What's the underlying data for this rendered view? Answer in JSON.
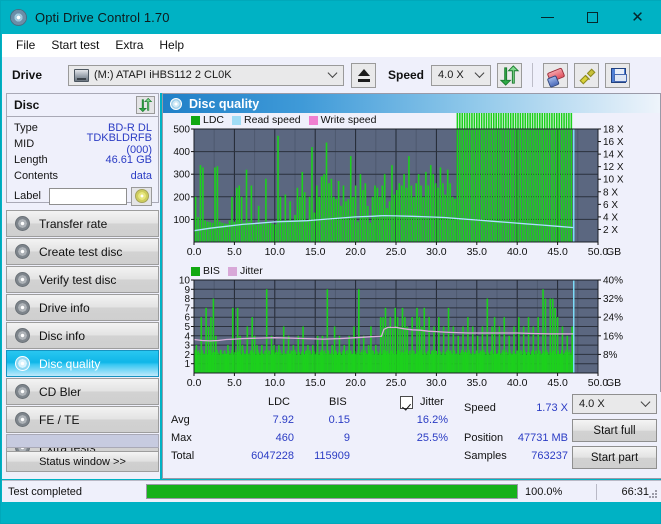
{
  "window": {
    "title": "Opti Drive Control 1.70",
    "icon": "disc-icon",
    "minimize": "minimize-icon",
    "maximize": "maximize-icon",
    "close": "close-icon",
    "titlebar_color": "#00b2c4"
  },
  "menu": [
    {
      "label": "File"
    },
    {
      "label": "Start test"
    },
    {
      "label": "Extra"
    },
    {
      "label": "Help"
    }
  ],
  "toolbar": {
    "drive_label": "Drive",
    "drive_value": "(M:) ATAPI iHBS112  2 CL0K",
    "eject_title": "eject-button",
    "speed_label": "Speed",
    "speed_value": "4.0 X",
    "refresh_title": "refresh-button",
    "erase_title": "erase-button",
    "plug_title": "plug-button",
    "save_title": "save-button"
  },
  "disc": {
    "title": "Disc",
    "rows": [
      {
        "key": "Type",
        "value": "BD-R DL"
      },
      {
        "key": "MID",
        "value": "TDKBLDRFB (000)"
      },
      {
        "key": "Length",
        "value": "46.61 GB"
      },
      {
        "key": "Contents",
        "value": "data"
      }
    ],
    "label_key": "Label",
    "label_value": "",
    "label_placeholder": ""
  },
  "sidebar": {
    "items": [
      {
        "label": "Transfer rate",
        "selected": false
      },
      {
        "label": "Create test disc",
        "selected": false
      },
      {
        "label": "Verify test disc",
        "selected": false
      },
      {
        "label": "Drive info",
        "selected": false
      },
      {
        "label": "Disc info",
        "selected": false
      },
      {
        "label": "Disc quality",
        "selected": true
      },
      {
        "label": "CD Bler",
        "selected": false
      },
      {
        "label": "FE / TE",
        "selected": false
      },
      {
        "label": "Extra tests",
        "selected": false
      }
    ],
    "status_window": "Status window >>"
  },
  "panel": {
    "title": "Disc quality",
    "icon": "disc-quality-icon"
  },
  "stats": {
    "col_ldc": "LDC",
    "col_bis": "BIS",
    "jitter_label": "Jitter",
    "jitter_checked": true,
    "rows": [
      {
        "name": "Avg",
        "ldc": "7.92",
        "bis": "0.15",
        "jitter": "16.2%"
      },
      {
        "name": "Max",
        "ldc": "460",
        "bis": "9",
        "jitter": "25.5%"
      },
      {
        "name": "Total",
        "ldc": "6047228",
        "bis": "115909",
        "jitter": ""
      }
    ],
    "speed_key": "Speed",
    "speed_val": "1.73 X",
    "position_key": "Position",
    "position_val": "47731 MB",
    "samples_key": "Samples",
    "samples_val": "763237",
    "speed_select": "4.0 X",
    "start_full": "Start full",
    "start_part": "Start part"
  },
  "statusbar": {
    "text": "Test completed",
    "percent_label": "100.0%",
    "percent_value": 100,
    "elapsed": "66:31",
    "bar_color": "#16b11a"
  },
  "chart_data": [
    {
      "type": "line",
      "name": "ldc-chart",
      "title": "",
      "xlabel": "GB",
      "ylabel": "",
      "xlim": [
        0,
        50
      ],
      "ylim": [
        0,
        500
      ],
      "y2lim": [
        0,
        18
      ],
      "xticks": [
        "0.0",
        "5.0",
        "10.0",
        "15.0",
        "20.0",
        "25.0",
        "30.0",
        "35.0",
        "40.0",
        "45.0",
        "50.0"
      ],
      "yticks": [
        "100",
        "200",
        "300",
        "400",
        "500"
      ],
      "y2ticks": [
        "2 X",
        "4 X",
        "6 X",
        "8 X",
        "10 X",
        "12 X",
        "14 X",
        "16 X",
        "18 X"
      ],
      "grid": true,
      "legend": [
        {
          "label": "LDC",
          "color": "#11a811"
        },
        {
          "label": "Read speed",
          "color": "#9fdcf5"
        },
        {
          "label": "Write speed",
          "color": "#ef7fd0"
        }
      ],
      "plot_bg": "#5b6780",
      "data_end_gb": 47.0,
      "series": [
        {
          "name": "LDC",
          "color": "#1cd11c",
          "kind": "spikes",
          "x": [
            0.2,
            0.5,
            0.8,
            1.1,
            1.4,
            1.7,
            2.0,
            2.3,
            2.6,
            2.9,
            3.2,
            3.5,
            3.8,
            4.1,
            4.4,
            4.7,
            5.0,
            5.3,
            5.6,
            5.9,
            6.2,
            6.5,
            6.8,
            7.1,
            7.4,
            7.7,
            8.0,
            8.3,
            8.6,
            8.9,
            9.2,
            9.5,
            9.8,
            10.1,
            10.4,
            10.7,
            11.0,
            11.3,
            11.6,
            11.9,
            12.2,
            12.5,
            12.8,
            13.1,
            13.4,
            13.7,
            14.0,
            14.3,
            14.6,
            14.9,
            15.2,
            15.5,
            15.8,
            16.1,
            16.4,
            16.7,
            17.0,
            17.3,
            17.6,
            17.9,
            18.2,
            18.5,
            18.8,
            19.1,
            19.4,
            19.7,
            20.0,
            20.3,
            20.6,
            20.9,
            21.2,
            21.5,
            21.8,
            22.1,
            22.4,
            22.7,
            23.0,
            23.3,
            23.6,
            23.9,
            24.2,
            24.5,
            24.8,
            25.1,
            25.4,
            25.7,
            26.0,
            26.3,
            26.6,
            26.9,
            27.2,
            27.5,
            27.8,
            28.1,
            28.4,
            28.7,
            29.0,
            29.3,
            29.6,
            29.9,
            30.2,
            30.5,
            30.8,
            31.1,
            31.4,
            31.7,
            32.0,
            32.3,
            32.6,
            32.9,
            33.2,
            33.5,
            33.8,
            34.1,
            34.4,
            34.7,
            35.0,
            35.3,
            35.6,
            35.9,
            36.2,
            36.5,
            36.8,
            37.1,
            37.4,
            37.7,
            38.0,
            38.3,
            38.6,
            38.9,
            39.2,
            39.5,
            39.8,
            40.1,
            40.4,
            40.7,
            41.0,
            41.3,
            41.6,
            41.9,
            42.2,
            42.5,
            42.8,
            43.1,
            43.4,
            43.7,
            44.0,
            44.3,
            44.6,
            44.9,
            45.2,
            45.5,
            45.8,
            46.1,
            46.4,
            46.7
          ],
          "y": [
            200,
            110,
            340,
            330,
            95,
            90,
            88,
            85,
            330,
            335,
            90,
            85,
            82,
            80,
            95,
            200,
            90,
            240,
            250,
            200,
            85,
            320,
            90,
            250,
            80,
            75,
            160,
            78,
            80,
            280,
            82,
            85,
            80,
            78,
            470,
            200,
            88,
            210,
            95,
            180,
            90,
            120,
            240,
            200,
            310,
            220,
            95,
            200,
            420,
            130,
            250,
            200,
            290,
            300,
            440,
            260,
            280,
            200,
            190,
            270,
            160,
            250,
            180,
            190,
            380,
            200,
            250,
            90,
            300,
            230,
            260,
            160,
            85,
            200,
            250,
            240,
            200,
            250,
            300,
            150,
            180,
            340,
            210,
            230,
            260,
            250,
            300,
            240,
            380,
            250,
            200,
            260,
            300,
            250,
            200,
            310,
            250,
            340,
            300,
            260,
            240,
            330,
            260,
            210,
            320,
            260,
            200,
            190
          ]
        },
        {
          "name": "Read speed",
          "color": "#a9e4f8",
          "kind": "line",
          "x": [
            0,
            2,
            4,
            6,
            8,
            10,
            12,
            14,
            16,
            18,
            20,
            22,
            23.5,
            25,
            27,
            29,
            31,
            33,
            35,
            37,
            39,
            41,
            43,
            45,
            47
          ],
          "y": [
            1.8,
            2.2,
            2.5,
            2.8,
            3.0,
            3.2,
            3.3,
            3.4,
            3.6,
            3.8,
            4.0,
            4.1,
            4.2,
            4.15,
            4.1,
            4.0,
            3.9,
            3.7,
            3.5,
            3.3,
            3.1,
            2.9,
            2.7,
            2.5,
            2.3
          ]
        }
      ]
    },
    {
      "type": "line",
      "name": "bis-chart",
      "title": "",
      "xlabel": "GB",
      "ylabel": "",
      "xlim": [
        0,
        50
      ],
      "ylim": [
        0,
        10
      ],
      "y2lim": [
        0,
        40
      ],
      "xticks": [
        "0.0",
        "5.0",
        "10.0",
        "15.0",
        "20.0",
        "25.0",
        "30.0",
        "35.0",
        "40.0",
        "45.0",
        "50.0"
      ],
      "yticks": [
        "1",
        "2",
        "3",
        "4",
        "5",
        "6",
        "7",
        "8",
        "9",
        "10"
      ],
      "y2ticks": [
        "8%",
        "16%",
        "24%",
        "32%",
        "40%"
      ],
      "grid": true,
      "legend": [
        {
          "label": "BIS",
          "color": "#11a811"
        },
        {
          "label": "Jitter",
          "color": "#d8a8d8"
        }
      ],
      "plot_bg": "#5b6780",
      "data_end_gb": 47.0,
      "series": [
        {
          "name": "BIS",
          "color": "#1cd11c",
          "kind": "spikes",
          "base": 2.0,
          "x": [
            0.3,
            0.9,
            1.5,
            1.8,
            2.1,
            2.4,
            2.7,
            3.3,
            4.2,
            4.8,
            5.4,
            5.7,
            6.0,
            6.6,
            7.2,
            7.5,
            7.8,
            8.4,
            9.0,
            9.6,
            9.9,
            10.5,
            11.1,
            11.7,
            12.3,
            12.9,
            13.5,
            14.1,
            14.7,
            15.3,
            15.9,
            16.5,
            17.1,
            17.4,
            18.0,
            18.6,
            19.2,
            19.8,
            20.4,
            21.0,
            21.6,
            21.9,
            22.5,
            23.1,
            23.4,
            23.7,
            24.0,
            24.3,
            24.6,
            24.9,
            25.2,
            25.5,
            25.8,
            26.1,
            26.4,
            27.0,
            27.6,
            27.9,
            28.2,
            28.5,
            29.1,
            29.7,
            30.3,
            30.9,
            31.5,
            32.1,
            32.7,
            33.3,
            33.9,
            34.5,
            35.1,
            35.7,
            36.3,
            36.9,
            37.2,
            37.8,
            38.4,
            39.0,
            39.6,
            40.2,
            40.8,
            41.4,
            42.0,
            42.6,
            43.2,
            43.5,
            44.1,
            44.4,
            44.7,
            45.0,
            45.6,
            46.2,
            46.8
          ],
          "y": [
            3,
            6,
            7,
            5,
            6,
            8,
            4,
            2.5,
            3,
            7,
            7,
            4,
            3,
            5,
            6,
            4,
            3,
            3,
            9,
            4,
            3,
            3,
            5,
            4,
            3,
            4,
            5,
            3,
            3,
            4,
            4,
            9,
            3,
            5,
            4,
            3,
            4,
            5,
            9,
            4,
            3,
            5,
            3,
            6,
            6,
            7,
            5,
            6,
            5,
            7,
            6,
            5,
            7,
            6,
            5,
            6,
            7,
            6,
            5,
            7,
            6,
            5,
            6,
            5,
            7,
            5,
            4,
            5,
            6,
            5,
            4,
            5,
            8,
            5,
            6,
            5,
            6,
            4,
            5,
            6,
            5,
            6,
            5,
            6,
            9,
            8,
            8,
            8,
            7,
            6,
            5,
            4,
            5
          ]
        },
        {
          "name": "Jitter",
          "color": "#d9aed9",
          "kind": "line",
          "x": [
            0,
            1,
            2,
            3,
            4,
            5,
            6,
            8,
            10,
            12,
            14,
            16,
            18,
            20,
            22,
            23.2,
            23.5,
            24,
            25,
            26,
            27,
            28,
            29,
            30,
            31,
            32,
            34,
            36,
            38,
            40,
            42,
            44,
            46,
            47
          ],
          "y": [
            3.6,
            3.5,
            3.45,
            3.5,
            3.6,
            3.65,
            3.7,
            3.75,
            3.8,
            3.75,
            3.7,
            3.65,
            3.7,
            3.8,
            3.9,
            3.95,
            4.7,
            4.9,
            4.9,
            4.75,
            4.65,
            4.6,
            4.5,
            4.45,
            4.4,
            4.35,
            4.3,
            4.3,
            4.3,
            4.3,
            4.25,
            4.2,
            4.2,
            4.2
          ]
        }
      ]
    }
  ]
}
